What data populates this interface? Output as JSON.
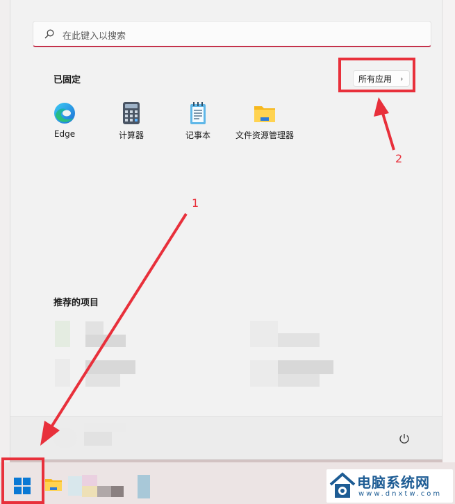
{
  "search": {
    "placeholder": "在此键入以搜索"
  },
  "pinned": {
    "title": "已固定",
    "all_apps_label": "所有应用",
    "apps": [
      {
        "label": "Edge",
        "icon": "edge-icon"
      },
      {
        "label": "计算器",
        "icon": "calculator-icon"
      },
      {
        "label": "记事本",
        "icon": "notepad-icon"
      },
      {
        "label": "文件资源管理器",
        "icon": "file-explorer-icon"
      }
    ]
  },
  "recommended": {
    "title": "推荐的项目"
  },
  "annotations": {
    "step1": "1",
    "step2": "2",
    "highlight_color": "#e8303b"
  },
  "watermark": {
    "name": "电脑系统网",
    "url": "www.dnxtw.com"
  },
  "colors": {
    "search_accent": "#c4314b",
    "win_blue": "#0a78d4",
    "watermark_blue": "#1d5c94"
  }
}
